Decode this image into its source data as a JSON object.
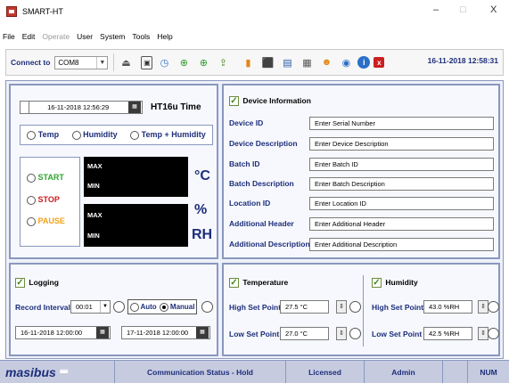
{
  "window": {
    "title": "SMART-HT",
    "minimize": "–",
    "maximize": "□",
    "close": "X"
  },
  "menu": [
    "File",
    "Edit",
    "Operate",
    "User",
    "System",
    "Tools",
    "Help"
  ],
  "toolbar": {
    "connect_label": "Connect to",
    "port_value": "COM8",
    "datetime": "16-11-2018 12:58:31",
    "icons": [
      "eject-icon",
      "device-icon",
      "clock-icon",
      "save-icon",
      "load-icon",
      "export-icon",
      "chart-icon",
      "pdf-icon",
      "report-icon",
      "log-icon",
      "users-icon",
      "refresh-icon",
      "info-icon",
      "exit-icon"
    ]
  },
  "time_panel": {
    "datetime": "16-11-2018 12:56:29",
    "label": "HT16u Time"
  },
  "mode": {
    "options": [
      "Temp",
      "Humidity",
      "Temp + Humidity"
    ]
  },
  "controls": {
    "start": "START",
    "stop": "STOP",
    "pause": "PAUSE"
  },
  "display": {
    "max": "MAX",
    "min": "MIN",
    "unit_temp": "°C",
    "unit_rh_pct": "%",
    "unit_rh": "RH"
  },
  "device_info": {
    "title": "Device Information",
    "fields": [
      {
        "label": "Device ID",
        "value": "Enter Serial Number"
      },
      {
        "label": "Device Description",
        "value": "Enter Device Description"
      },
      {
        "label": "Batch ID",
        "value": "Enter Batch ID"
      },
      {
        "label": "Batch Description",
        "value": "Enter Batch Description"
      },
      {
        "label": "Location ID",
        "value": "Enter Location ID"
      },
      {
        "label": "Additional Header",
        "value": "Enter Additional Header"
      },
      {
        "label": "Additional Description",
        "value": "Enter Additional Description"
      }
    ]
  },
  "logging": {
    "title": "Logging",
    "record_interval_label": "Record Interval",
    "record_interval": "00:01",
    "auto": "Auto",
    "manual": "Manual",
    "start_datetime": "16-11-2018 12:00:00",
    "end_datetime": "17-11-2018 12:00:00"
  },
  "temperature": {
    "title": "Temperature",
    "high_label": "High Set Point",
    "high": "27.5 °C",
    "low_label": "Low Set Point",
    "low": "27.0 °C"
  },
  "humidity": {
    "title": "Humidity",
    "high_label": "High Set Point",
    "high": "43.0 %RH",
    "low_label": "Low Set Point",
    "low": "42.5 %RH"
  },
  "status": {
    "brand": "masibus",
    "communication": "Communication Status - Hold",
    "license": "Licensed",
    "user": "Admin",
    "num": "NUM"
  },
  "colors": {
    "label_blue": "#1d2e7a",
    "start_green": "#2ea52e",
    "stop_red": "#cc1f1f",
    "pause_orange": "#f2a21b",
    "panel_border": "#8a98bf"
  }
}
